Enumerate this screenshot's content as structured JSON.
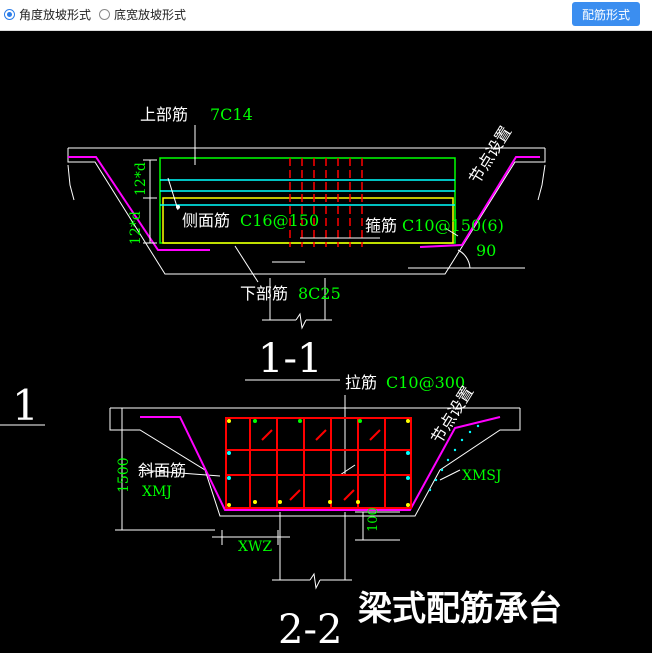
{
  "toolbar": {
    "options": [
      {
        "label": "角度放坡形式",
        "checked": true
      },
      {
        "label": "底宽放坡形式",
        "checked": false
      }
    ],
    "button_label": "配筋形式"
  },
  "section_1": {
    "top_bar_label": "上部筋",
    "top_bar_value": "7C14",
    "side_bar_label": "侧面筋",
    "side_bar_value": "C16@150",
    "stirrup_label": "箍筋",
    "stirrup_value": "C10@150(6)",
    "bottom_bar_label": "下部筋",
    "bottom_bar_value": "8C25",
    "node_setting": "节点设置",
    "dim_left_upper": "12*d",
    "dim_left_lower": "12*d",
    "angle": "90",
    "title": "1-1"
  },
  "section_2": {
    "tie_bar_label": "拉筋",
    "tie_bar_value": "C10@300",
    "slope_bar_label": "斜面筋",
    "slope_bar_value": "XMJ",
    "node_setting": "节点设置",
    "xmsj": "XMSJ",
    "height": "1500",
    "xwz": "XWZ",
    "dim_100": "100",
    "title": "2-2"
  },
  "side_mark": "1",
  "main_title": "梁式配筋承台",
  "colors": {
    "canvas": "#000000",
    "line_white": "#ffffff",
    "rebar_green": "#00ff00",
    "rebar_cyan": "#00ffff",
    "rebar_red": "#ff0000",
    "side_yellow": "#ffff00",
    "slope_magenta": "#ff00ff",
    "label_green": "#00ff00",
    "accent_button": "#3b8ef0"
  }
}
